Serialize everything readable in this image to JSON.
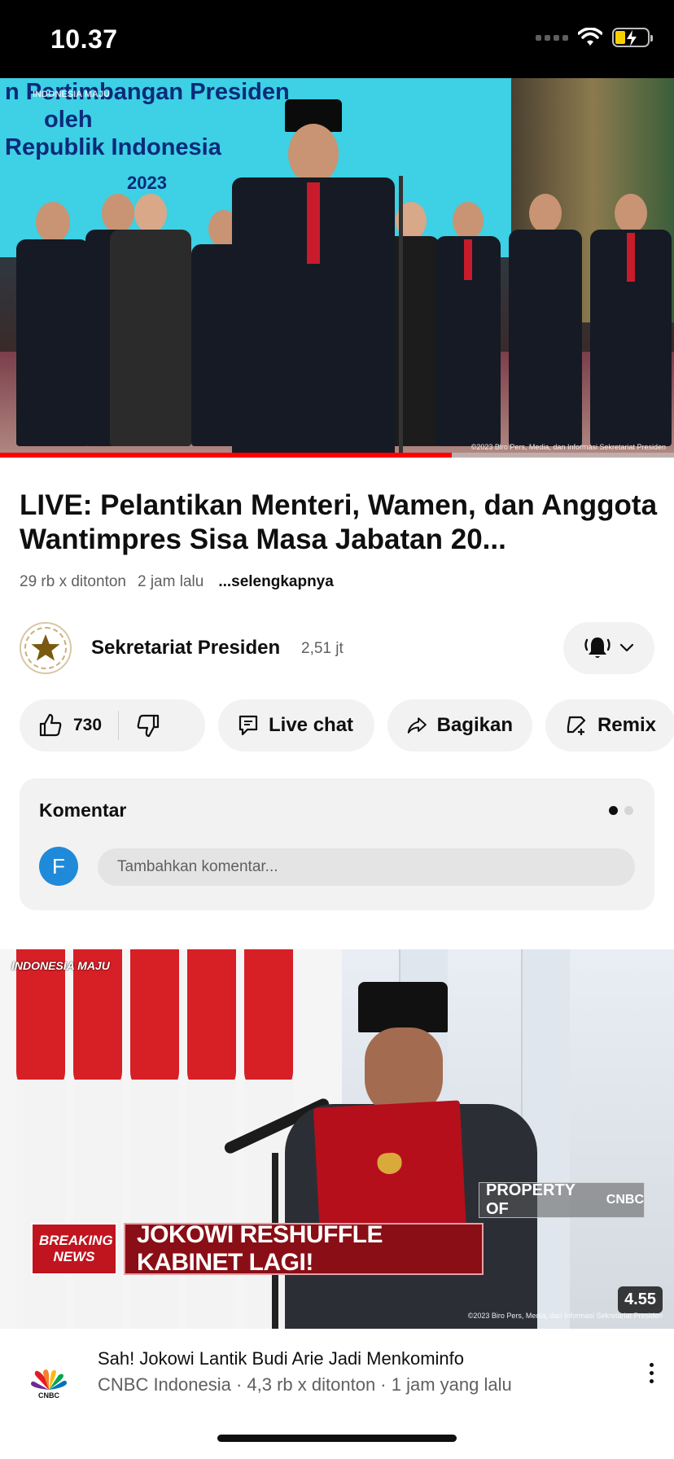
{
  "status_bar": {
    "time": "10.37"
  },
  "player": {
    "banner_lines": [
      "n Pertimbangan Presiden",
      "oleh",
      "Republik Indonesia",
      "2023"
    ],
    "watermark": "INDONESIA MAJU",
    "copyright": "©2023 Biro Pers, Media, dan Informasi Sekretariat Presiden",
    "progress": 0.67,
    "progress_color": "#ff0000"
  },
  "video": {
    "title": "LIVE: Pelantikan Menteri, Wamen, dan Anggota Wantimpres Sisa Masa Jabatan 20...",
    "views": "29 rb x ditonton",
    "age": "2 jam lalu",
    "more": "...selengkapnya"
  },
  "channel": {
    "name": "Sekretariat Presiden",
    "subscribers": "2,51 jt",
    "avatar_icon": "star-emblem-icon",
    "bell_icon": "bell-ringing-icon"
  },
  "actions": {
    "like_count": "730",
    "live_chat": "Live chat",
    "share": "Bagikan",
    "remix": "Remix"
  },
  "comments": {
    "header": "Komentar",
    "user_initial": "F",
    "placeholder": "Tambahkan komentar...",
    "avatar_color": "#1f8ad9"
  },
  "next_video": {
    "watermark": "INDONESIA MAJU",
    "breaking": "BREAKING NEWS",
    "headline": "JOKOWI RESHUFFLE KABINET LAGI!",
    "property": "PROPERTY OF",
    "property_brand": "CNBC",
    "duration": "4.55",
    "copyright": "©2023 Biro Pers, Media, dan Informasi Sekretariat Presiden",
    "title": "Sah! Jokowi Lantik Budi Arie Jadi Menkominfo",
    "subtitle": "CNBC Indonesia · 4,3 rb x ditonton · 1 jam yang lalu",
    "channel_logo": "CNBC"
  },
  "colors": {
    "accent_red": "#ff0000",
    "chip_bg": "#f2f2f2"
  }
}
